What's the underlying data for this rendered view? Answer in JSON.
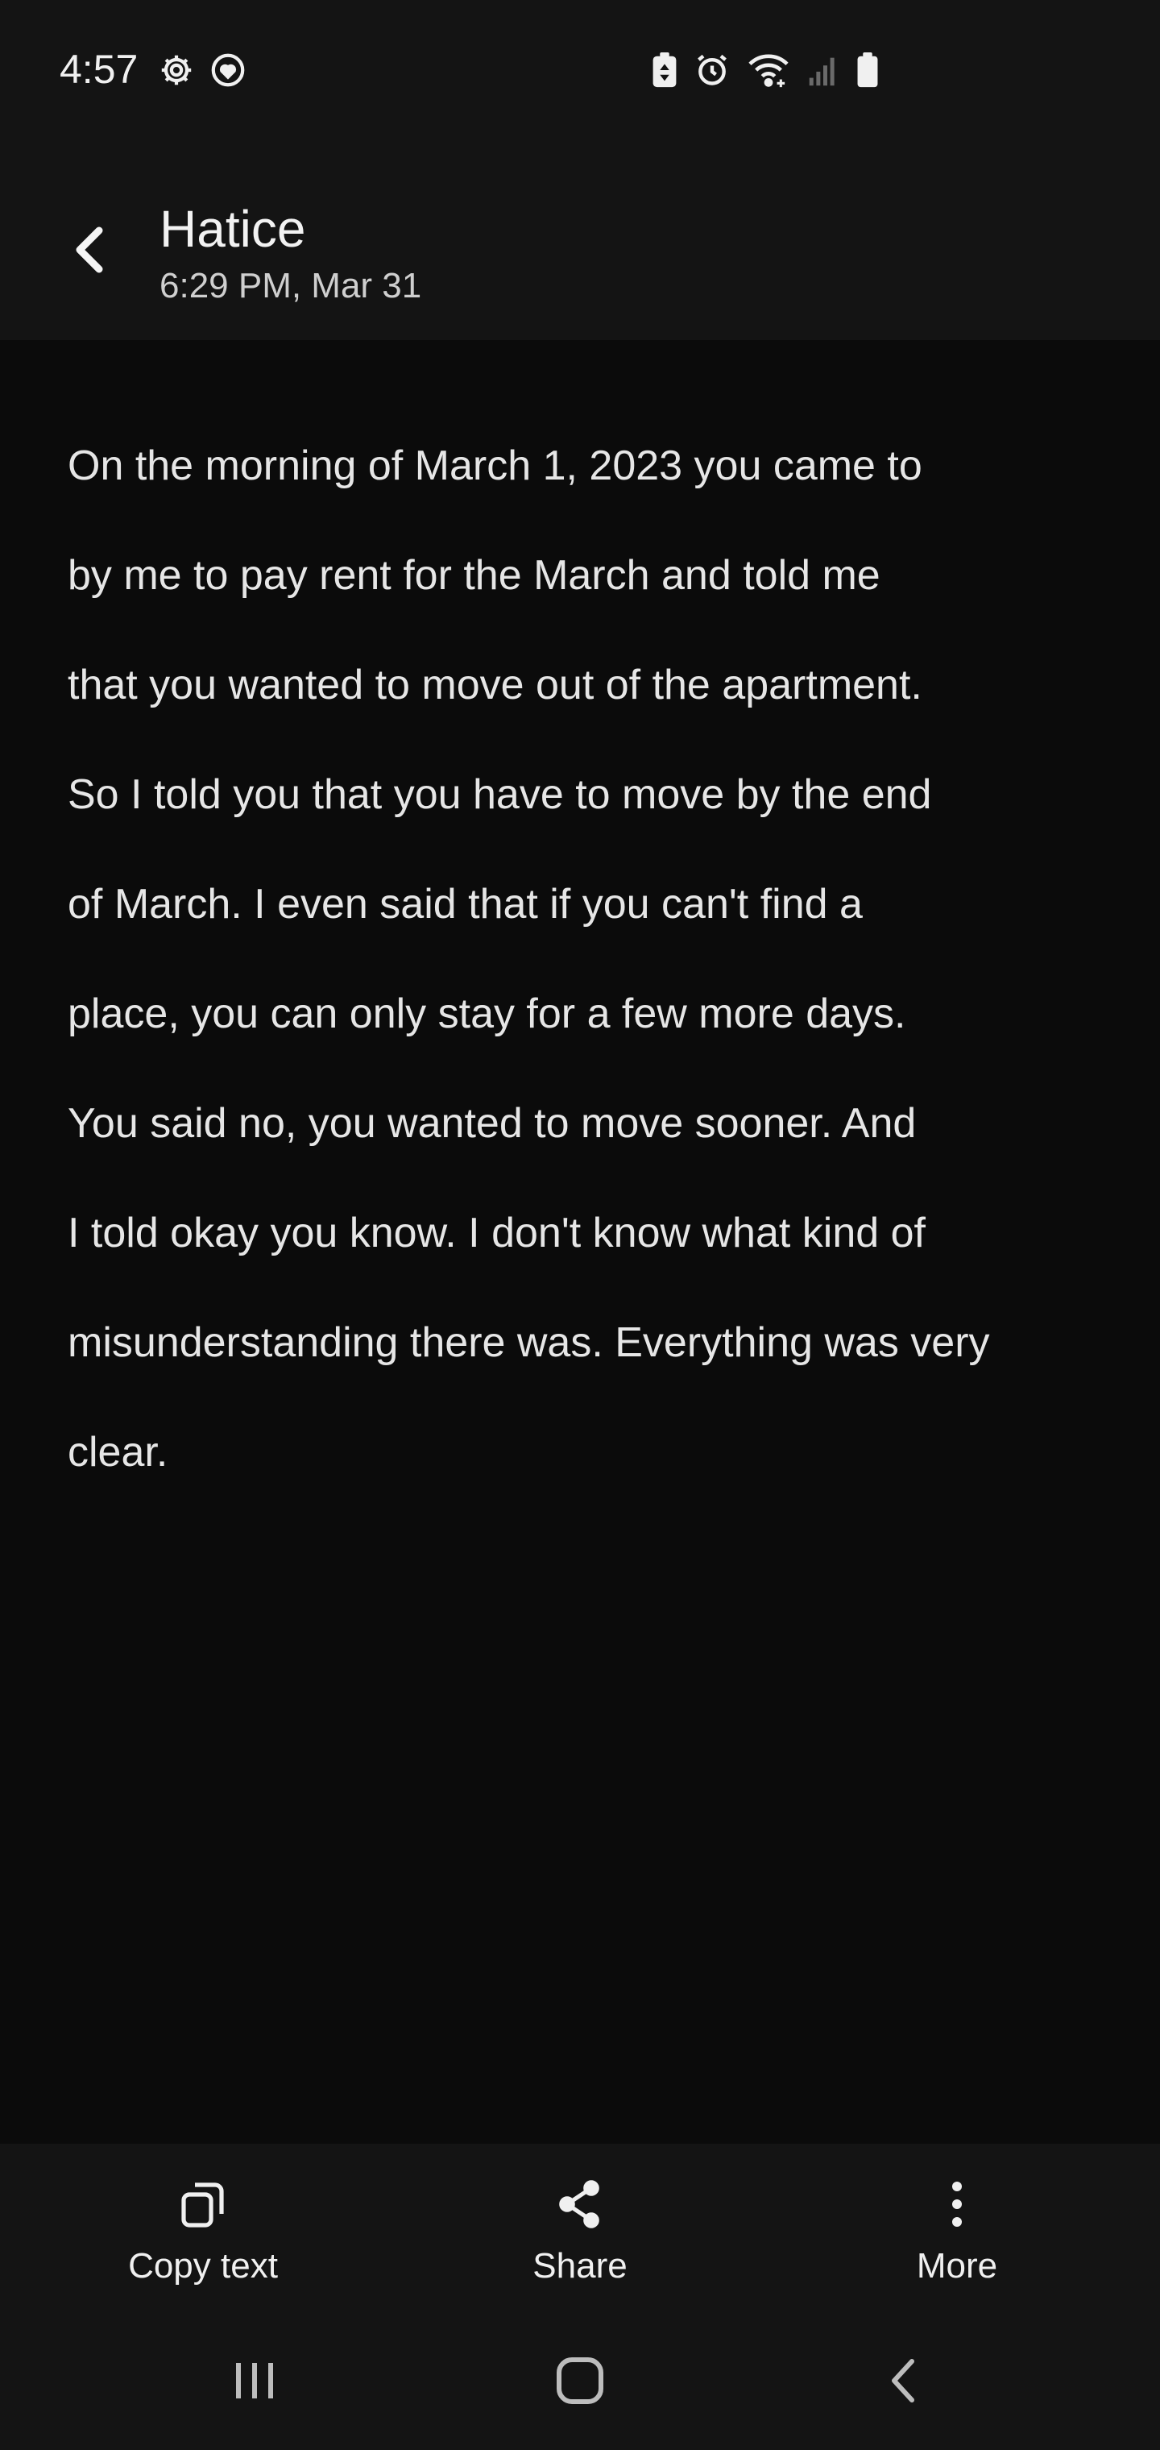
{
  "status_bar": {
    "time": "4:57",
    "icons": [
      "settings-gear-icon",
      "heart-badge-icon",
      "battery-saver-icon",
      "alarm-icon",
      "wifi-icon",
      "signal-icon",
      "battery-icon"
    ]
  },
  "header": {
    "back_icon": "chevron-left-icon",
    "title": "Hatice",
    "subtitle": "6:29 PM, Mar 31"
  },
  "message": {
    "lines": [
      "On the morning of March 1, 2023 you came to",
      "by me to pay rent for the March and told me",
      "that you wanted to move out of the apartment.",
      "So I told you that you have to move by the end",
      "of March. I even said that if you can't find a",
      "place, you can only stay for a few more days.",
      "You said no, you wanted to move sooner. And",
      "I told okay you know. I don't know what kind of",
      "misunderstanding there was. Everything was very",
      "clear."
    ]
  },
  "actions": {
    "copy_label": "Copy text",
    "share_label": "Share",
    "more_label": "More"
  },
  "nav": {
    "recents_icon": "recents-icon",
    "home_icon": "home-icon",
    "back_icon": "back-icon"
  },
  "colors": {
    "background": "#0b0b0b",
    "bar_background": "#141414",
    "text": "#e6e6e6",
    "secondary_text": "#cfcfcf"
  }
}
